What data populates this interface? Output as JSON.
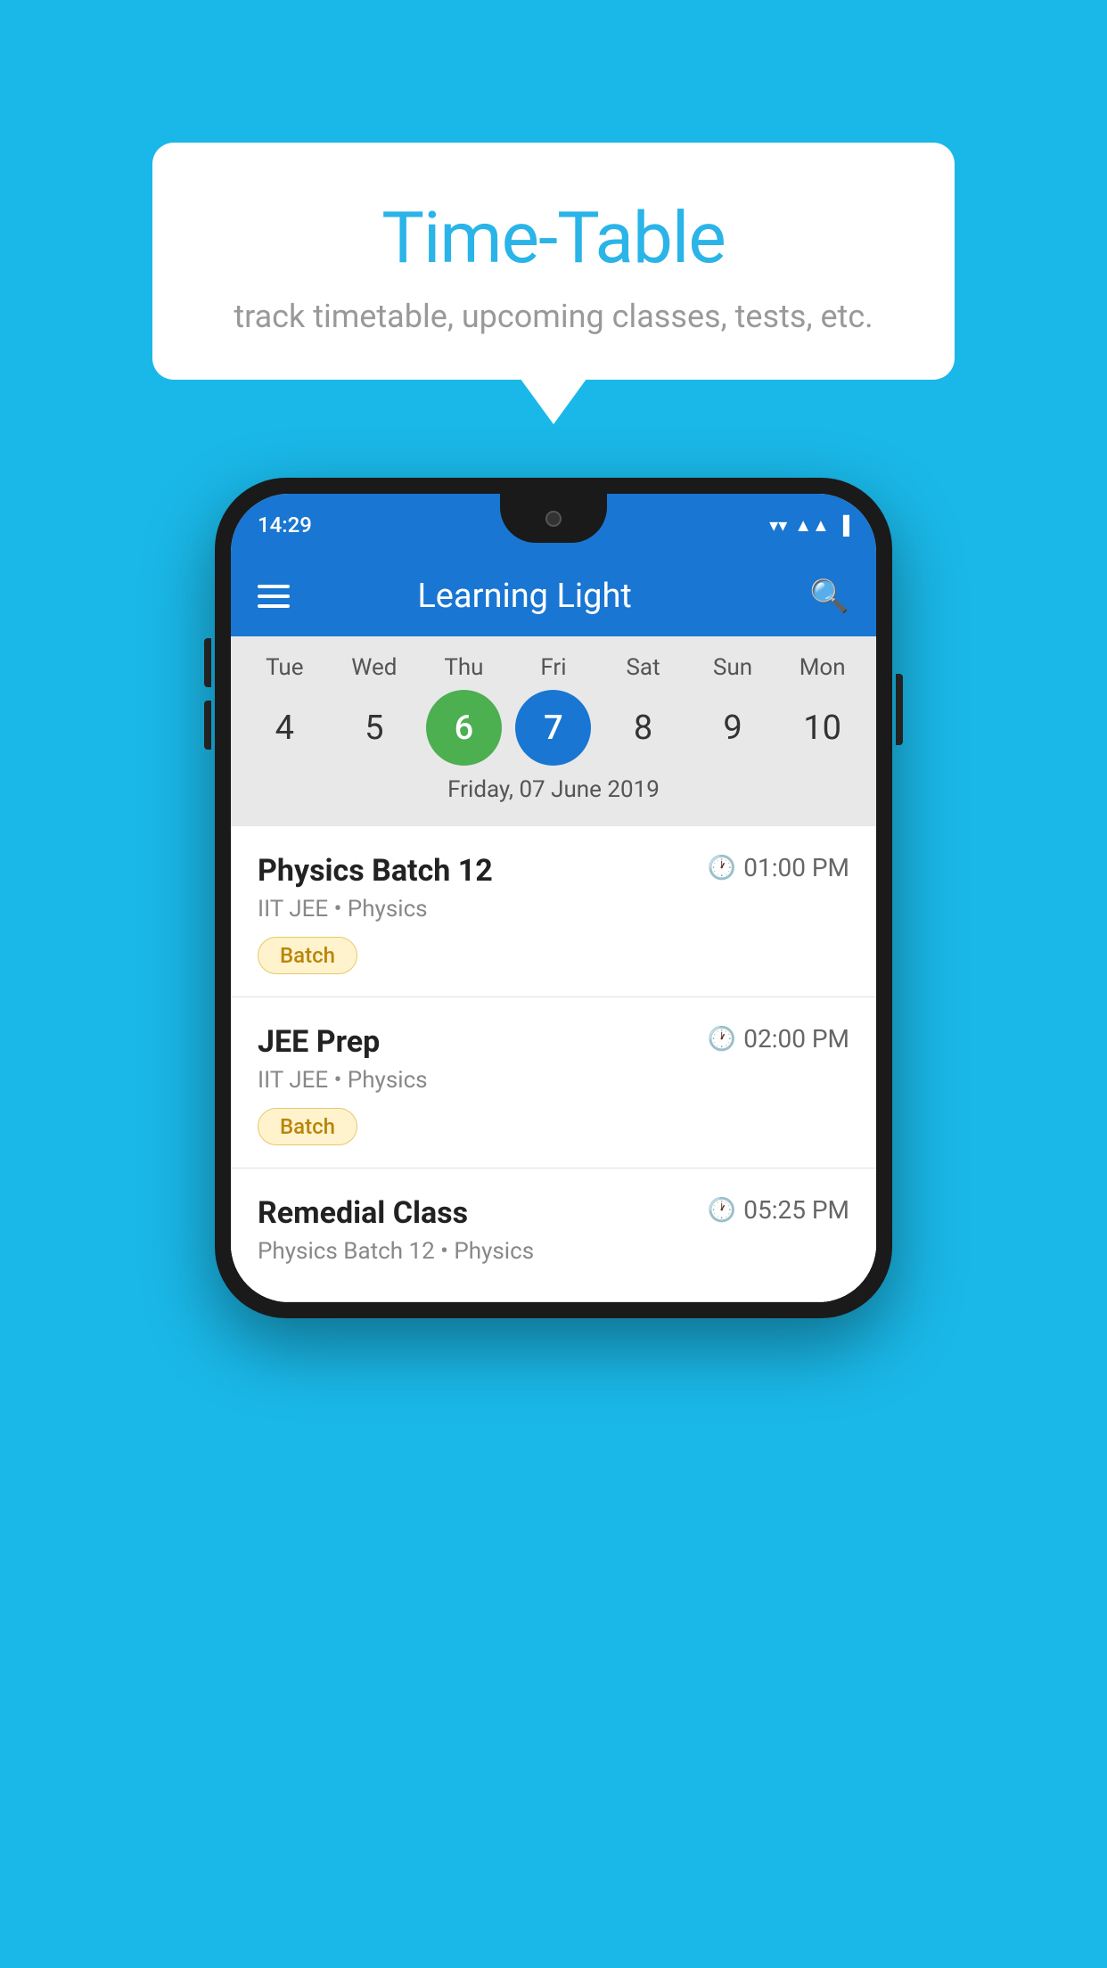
{
  "background": "#1ab8e8",
  "tooltip": {
    "title": "Time-Table",
    "subtitle": "track timetable, upcoming classes, tests, etc."
  },
  "phone": {
    "statusBar": {
      "time": "14:29",
      "icons": [
        "▼▲",
        "▲▲",
        "▐"
      ]
    },
    "appBar": {
      "title": "Learning Light",
      "searchLabel": "search"
    },
    "calendar": {
      "days": [
        {
          "label": "Tue",
          "num": "4"
        },
        {
          "label": "Wed",
          "num": "5"
        },
        {
          "label": "Thu",
          "num": "6",
          "state": "today"
        },
        {
          "label": "Fri",
          "num": "7",
          "state": "selected"
        },
        {
          "label": "Sat",
          "num": "8"
        },
        {
          "label": "Sun",
          "num": "9"
        },
        {
          "label": "Mon",
          "num": "10"
        }
      ],
      "selectedDateLabel": "Friday, 07 June 2019"
    },
    "schedule": [
      {
        "title": "Physics Batch 12",
        "time": "01:00 PM",
        "subtitle": "IIT JEE • Physics",
        "badge": "Batch"
      },
      {
        "title": "JEE Prep",
        "time": "02:00 PM",
        "subtitle": "IIT JEE • Physics",
        "badge": "Batch"
      },
      {
        "title": "Remedial Class",
        "time": "05:25 PM",
        "subtitle": "Physics Batch 12 • Physics",
        "badge": null
      }
    ]
  }
}
